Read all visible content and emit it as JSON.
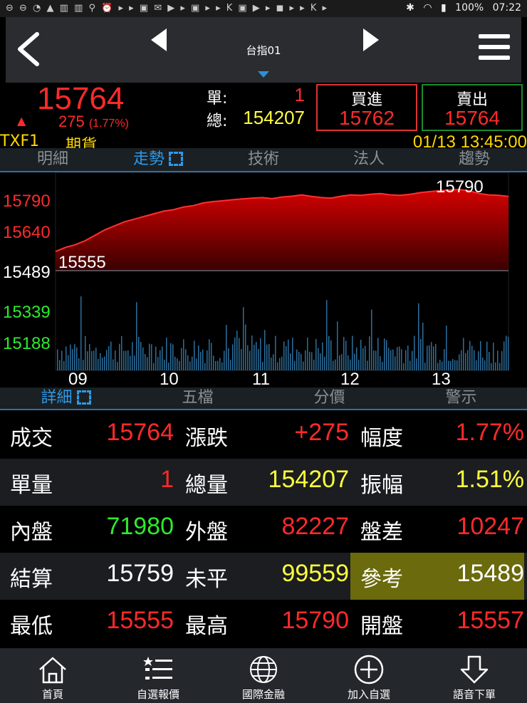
{
  "status_bar": {
    "battery": "100%",
    "time": "07:22"
  },
  "header": {
    "title": "台指01"
  },
  "quote": {
    "last": "15764",
    "change": "275",
    "change_pct": "(1.77%)",
    "single_label": "單:",
    "single_value": "1",
    "total_label": "總:",
    "total_value": "154207",
    "buy_label": "買進",
    "buy_price": "15762",
    "sell_label": "賣出",
    "sell_price": "15764",
    "contract_code": "TXF1",
    "contract_type": "期貨",
    "timestamp": "01/13 13:45:00"
  },
  "chart_tabs": [
    "明細",
    "走勢",
    "技術",
    "法人",
    "趨勢"
  ],
  "chart_data": {
    "type": "area",
    "price_ticks": [
      "15790",
      "15640",
      "15489",
      "15339",
      "15188"
    ],
    "reference": 15489,
    "high_label": "15790",
    "low_label": "15555",
    "x_ticks": [
      "09",
      "10",
      "11",
      "12",
      "13"
    ],
    "price_series": [
      15560,
      15575,
      15585,
      15600,
      15620,
      15640,
      15655,
      15670,
      15680,
      15690,
      15700,
      15710,
      15715,
      15725,
      15730,
      15740,
      15745,
      15748,
      15752,
      15755,
      15758,
      15760,
      15756,
      15762,
      15765,
      15770,
      15764,
      15760,
      15758,
      15765,
      15770,
      15768,
      15772,
      15775,
      15770,
      15768,
      15772,
      15778,
      15782,
      15785,
      15788,
      15790,
      15785,
      15775,
      15770,
      15768,
      15764
    ],
    "colors": {
      "up": "#ff2020",
      "fill_top": "#cc0000",
      "volume": "#2b6f9e"
    }
  },
  "detail_tabs": [
    "詳細",
    "五檔",
    "分價",
    "警示"
  ],
  "detail_rows": [
    [
      {
        "label": "成交",
        "value": "15764",
        "color": "red"
      },
      {
        "label": "漲跌",
        "value": "+275",
        "color": "red"
      },
      {
        "label": "幅度",
        "value": "1.77%",
        "color": "red"
      }
    ],
    [
      {
        "label": "單量",
        "value": "1",
        "color": "red"
      },
      {
        "label": "總量",
        "value": "154207",
        "color": "yellow"
      },
      {
        "label": "振幅",
        "value": "1.51%",
        "color": "yellow"
      }
    ],
    [
      {
        "label": "內盤",
        "value": "71980",
        "color": "green"
      },
      {
        "label": "外盤",
        "value": "82227",
        "color": "red"
      },
      {
        "label": "盤差",
        "value": "10247",
        "color": "red"
      }
    ],
    [
      {
        "label": "結算",
        "value": "15759",
        "color": "white"
      },
      {
        "label": "未平",
        "value": "99559",
        "color": "yellow"
      },
      {
        "label": "參考",
        "value": "15489",
        "color": "white"
      }
    ],
    [
      {
        "label": "最低",
        "value": "15555",
        "color": "red"
      },
      {
        "label": "最高",
        "value": "15790",
        "color": "red"
      },
      {
        "label": "開盤",
        "value": "15557",
        "color": "red"
      }
    ]
  ],
  "bottom_nav": [
    "首頁",
    "自選報價",
    "國際金融",
    "加入自選",
    "語音下單"
  ]
}
